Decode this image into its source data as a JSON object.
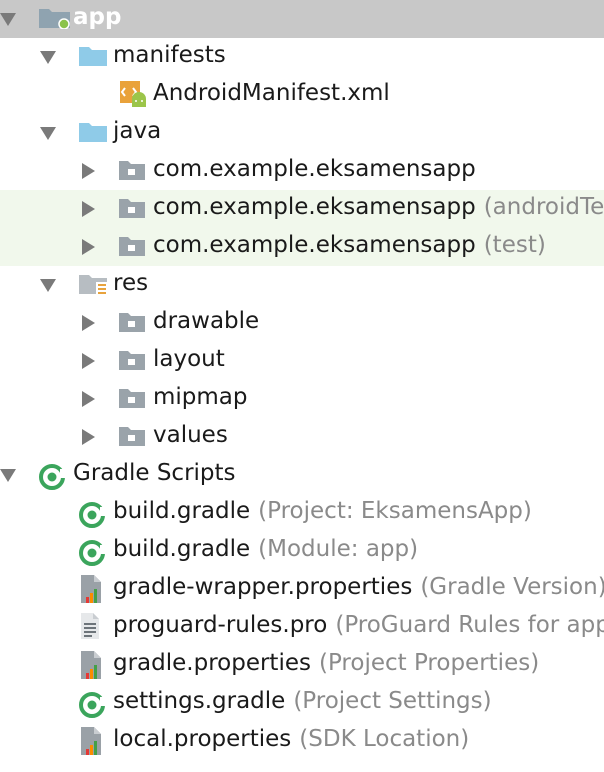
{
  "tree": [
    {
      "id": "app",
      "label": "app",
      "hint": "",
      "icon": "module-folder-icon",
      "arrow": "down",
      "level": 0,
      "header": true
    },
    {
      "id": "manifests",
      "label": "manifests",
      "hint": "",
      "icon": "folder-icon",
      "arrow": "down",
      "level": 1
    },
    {
      "id": "androidmanifest",
      "label": "AndroidManifest.xml",
      "hint": "",
      "icon": "manifest-xml-icon",
      "arrow": "none",
      "level": 2
    },
    {
      "id": "java",
      "label": "java",
      "hint": "",
      "icon": "folder-icon",
      "arrow": "down",
      "level": 1
    },
    {
      "id": "pkg-main",
      "label": "com.example.eksamensapp",
      "hint": "",
      "icon": "package-icon",
      "arrow": "right",
      "level": 2
    },
    {
      "id": "pkg-android-test",
      "label": "com.example.eksamensapp",
      "hint": "(androidTest)",
      "icon": "package-icon",
      "arrow": "right",
      "level": 2,
      "tint": true
    },
    {
      "id": "pkg-test",
      "label": "com.example.eksamensapp",
      "hint": "(test)",
      "icon": "package-icon",
      "arrow": "right",
      "level": 2,
      "tint": true
    },
    {
      "id": "res",
      "label": "res",
      "hint": "",
      "icon": "res-folder-icon",
      "arrow": "down",
      "level": 1
    },
    {
      "id": "drawable",
      "label": "drawable",
      "hint": "",
      "icon": "package-icon",
      "arrow": "right",
      "level": 2
    },
    {
      "id": "layout",
      "label": "layout",
      "hint": "",
      "icon": "package-icon",
      "arrow": "right",
      "level": 2
    },
    {
      "id": "mipmap",
      "label": "mipmap",
      "hint": "",
      "icon": "package-icon",
      "arrow": "right",
      "level": 2
    },
    {
      "id": "values",
      "label": "values",
      "hint": "",
      "icon": "package-icon",
      "arrow": "right",
      "level": 2
    },
    {
      "id": "gradle-scripts",
      "label": "Gradle Scripts",
      "hint": "",
      "icon": "gradle-icon",
      "arrow": "down",
      "level": 0
    },
    {
      "id": "build-gradle-project",
      "label": "build.gradle",
      "hint": "(Project: EksamensApp)",
      "icon": "gradle-icon",
      "arrow": "none",
      "level": 1
    },
    {
      "id": "build-gradle-module",
      "label": "build.gradle",
      "hint": "(Module: app)",
      "icon": "gradle-icon",
      "arrow": "none",
      "level": 1
    },
    {
      "id": "gradle-wrapper-properties",
      "label": "gradle-wrapper.properties",
      "hint": "(Gradle Version)",
      "icon": "properties-file-icon",
      "arrow": "none",
      "level": 1
    },
    {
      "id": "proguard-rules",
      "label": "proguard-rules.pro",
      "hint": "(ProGuard Rules for app)",
      "icon": "text-file-icon",
      "arrow": "none",
      "level": 1
    },
    {
      "id": "gradle-properties",
      "label": "gradle.properties",
      "hint": "(Project Properties)",
      "icon": "properties-file-icon",
      "arrow": "none",
      "level": 1
    },
    {
      "id": "settings-gradle",
      "label": "settings.gradle",
      "hint": "(Project Settings)",
      "icon": "gradle-icon",
      "arrow": "none",
      "level": 1
    },
    {
      "id": "local-properties",
      "label": "local.properties",
      "hint": "(SDK Location)",
      "icon": "properties-file-icon",
      "arrow": "none",
      "level": 1
    }
  ],
  "colors": {
    "header_bg": "#c8c8c8",
    "tint_bg": "#f1f8ec",
    "folder_blue": "#8fcbe8",
    "package_gray": "#9aa3aa",
    "gradle_green": "#3ba55c",
    "hint": "#8a8a8a"
  }
}
